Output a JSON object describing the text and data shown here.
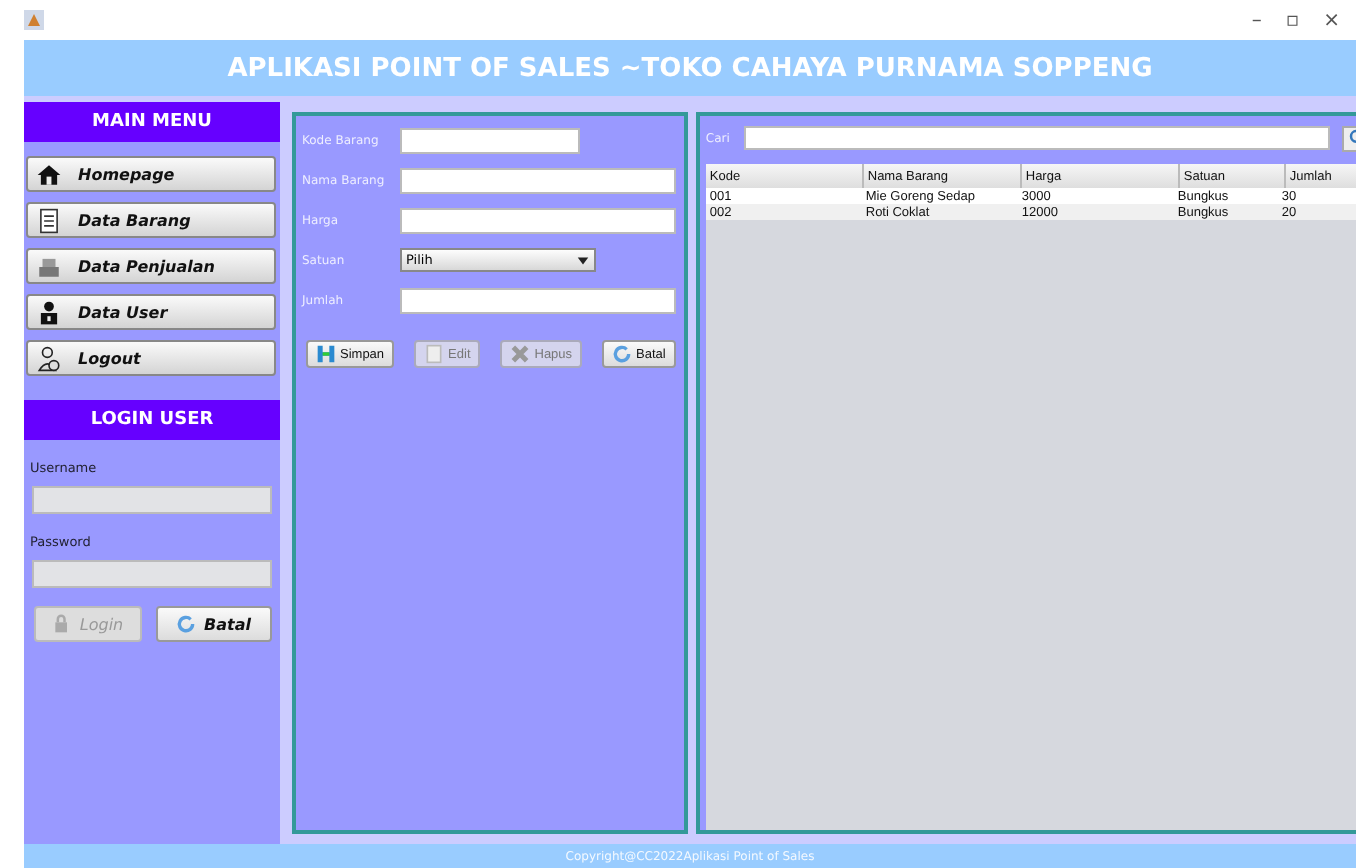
{
  "window": {
    "controls": [
      "–",
      "▫",
      "×"
    ]
  },
  "header": {
    "title": "APLIKASI POINT OF SALES ~TOKO CAHAYA PURNAMA SOPPENG"
  },
  "main_menu": {
    "title": "MAIN MENU",
    "items": [
      {
        "label": "Homepage",
        "kind": "house"
      },
      {
        "label": "Data Barang",
        "kind": "document"
      },
      {
        "label": "Data Penjualan",
        "kind": "register"
      },
      {
        "label": "Data User",
        "kind": "user"
      },
      {
        "label": "Logout",
        "kind": "logout"
      }
    ]
  },
  "login": {
    "title": "LOGIN USER",
    "username_label": "Username",
    "password_label": "Password",
    "buttons": [
      {
        "label": "Login",
        "kind": "lock",
        "disabled": true
      },
      {
        "label": "Batal",
        "kind": "refresh",
        "disabled": false
      }
    ]
  },
  "form": {
    "fields": [
      {
        "label": "Kode Barang",
        "kind": "short"
      },
      {
        "label": "Nama Barang",
        "kind": "text"
      },
      {
        "label": "Harga",
        "kind": "text"
      },
      {
        "label": "Satuan",
        "kind": "select",
        "value": "Pilih"
      },
      {
        "label": "Jumlah",
        "kind": "text"
      }
    ],
    "buttons": [
      {
        "label": "Simpan",
        "kind": "save",
        "disabled": false
      },
      {
        "label": "Edit",
        "kind": "edit",
        "disabled": true
      },
      {
        "label": "Hapus",
        "kind": "delete",
        "disabled": true
      },
      {
        "label": "Batal",
        "kind": "refresh",
        "disabled": false
      }
    ]
  },
  "search": {
    "label": "Cari"
  },
  "table": {
    "columns": [
      "Kode",
      "Nama Barang",
      "Harga",
      "Satuan",
      "Jumlah"
    ],
    "rows": [
      [
        "001",
        "Mie Goreng Sedap",
        "3000",
        "Bungkus",
        "30"
      ],
      [
        "002",
        "Roti Coklat",
        "12000",
        "Bungkus",
        "20"
      ]
    ]
  },
  "footer": {
    "text": "Copyright@CC2022Aplikasi Point of Sales"
  }
}
